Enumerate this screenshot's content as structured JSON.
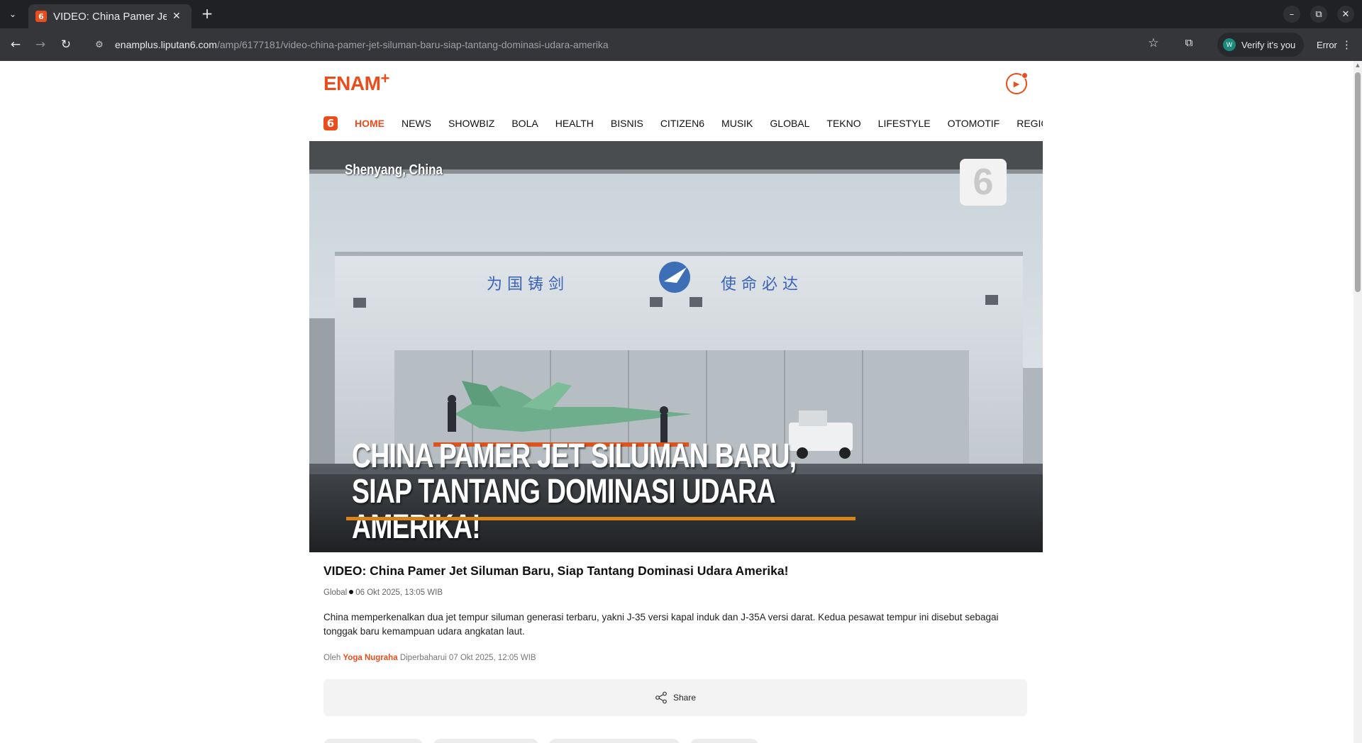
{
  "browser": {
    "tab_title": "VIDEO: China Pamer Jet Siluman Baru",
    "favicon_text": "6",
    "url_host": "enamplus.liputan6.com",
    "url_path": "/amp/6177181/video-china-pamer-jet-siluman-baru-siap-tantang-dominasi-udara-amerika",
    "verify_label": "Verify it's you",
    "verify_avatar": "W",
    "error_label": "Error"
  },
  "site": {
    "logo": "ENAM",
    "logo_plus": "+",
    "nav_logo": "6",
    "nav": [
      "HOME",
      "NEWS",
      "SHOWBIZ",
      "BOLA",
      "HEALTH",
      "BISNIS",
      "CITIZEN6",
      "MUSIK",
      "GLOBAL",
      "TEKNO",
      "LIFESTYLE",
      "OTOMOTIF",
      "REGIONAL"
    ],
    "active_nav": "HOME",
    "accent_color": "#ea4c1c"
  },
  "hero": {
    "location": "Shenyang, China",
    "badge": "6",
    "banner_text": "为 国 铸 剑       使 命 必 达",
    "caption_line1": "CHINA PAMER JET SILUMAN BARU,",
    "caption_line2": "SIAP TANTANG DOMINASI UDARA AMERIKA!"
  },
  "article": {
    "title": "VIDEO: China Pamer Jet Siluman Baru, Siap Tantang Dominasi Udara Amerika!",
    "category": "Global",
    "date": "06 Okt 2025, 13:05 WIB",
    "summary": "China memperkenalkan dua jet tempur siluman generasi terbaru, yakni J-35 versi kapal induk dan J-35A versi darat. Kedua pesawat tempur ini disebut sebagai tonggak baru kemampuan udara angkatan laut.",
    "by_label": "Oleh",
    "author": "Yoga Nugraha",
    "updated": "Diperbaharui 07 Okt 2025, 12:05 WIB",
    "share_label": "Share"
  }
}
